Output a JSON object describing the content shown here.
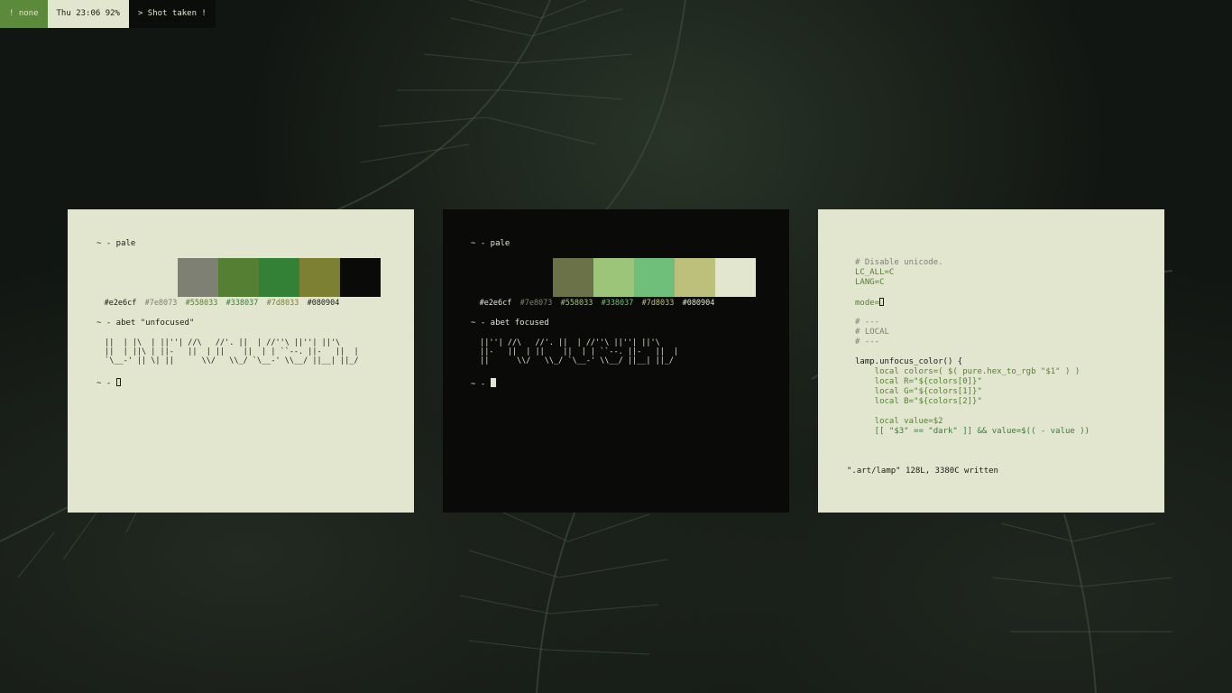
{
  "bar": {
    "workspace": "! none",
    "clock": "Thu 23:06 92%",
    "notification": "> Shot taken !"
  },
  "palette": {
    "colors": [
      "#e2e6cf",
      "#7e8073",
      "#558033",
      "#338037",
      "#7d8033",
      "#080904"
    ],
    "labels": [
      "#e2e6cf",
      "#7e8073",
      "#558033",
      "#338037",
      "#7d8033",
      "#080904"
    ]
  },
  "term_left": {
    "prompt1": "~ - pale",
    "prompt2": "~ - abet \"unfocused\"",
    "ascii": " ||  | |\\  | ||''| //\\   //'. ||  | //''\\ ||''| ||'\\\n ||  | ||\\ | ||-   ||  | ||    ||  | | ``--. ||-   ||  |\n `\\__-' || \\| ||      \\\\/   \\\\_/ `\\__-' \\\\__/ ||__| ||_/",
    "prompt3": "~ - "
  },
  "term_mid": {
    "prompt1": "~ - pale",
    "prompt2": "~ - abet focused",
    "ascii": " ||''| //\\   //'. ||  | //''\\ ||''| ||'\\\n ||-   ||  | ||    ||  | | ``--. ||-   ||  |\n ||      \\\\/   \\\\_/ `\\__-' \\\\__/ ||__| ||_/",
    "prompt3": "~ - "
  },
  "editor": {
    "lines": [
      {
        "cls": "c-comment",
        "text": "# Disable unicode."
      },
      {
        "cls": "c-var",
        "text": "LC_ALL=C"
      },
      {
        "cls": "c-var",
        "text": "LANG=C"
      },
      {
        "cls": "c-plain",
        "text": ""
      },
      {
        "cls": "c-var",
        "text": "mode="
      },
      {
        "cls": "c-plain",
        "text": ""
      },
      {
        "cls": "c-comment",
        "text": "# ---"
      },
      {
        "cls": "c-comment",
        "text": "# LOCAL"
      },
      {
        "cls": "c-comment",
        "text": "# ---"
      },
      {
        "cls": "c-plain",
        "text": ""
      },
      {
        "cls": "c-plain",
        "text": "lamp.unfocus_color() {"
      },
      {
        "cls": "c-var",
        "text": "    local colors=( $( pure.hex_to_rgb \"$1\" ) )"
      },
      {
        "cls": "c-var",
        "text": "    local R=\"${colors[0]}\""
      },
      {
        "cls": "c-var",
        "text": "    local G=\"${colors[1]}\""
      },
      {
        "cls": "c-var",
        "text": "    local B=\"${colors[2]}\""
      },
      {
        "cls": "c-plain",
        "text": ""
      },
      {
        "cls": "c-var",
        "text": "    local value=$2"
      },
      {
        "cls": "c-str",
        "text": "    [[ \"$3\" == \"dark\" ]] && value=$(( - value ))"
      }
    ],
    "status": "\".art/lamp\" 128L, 3380C written"
  }
}
